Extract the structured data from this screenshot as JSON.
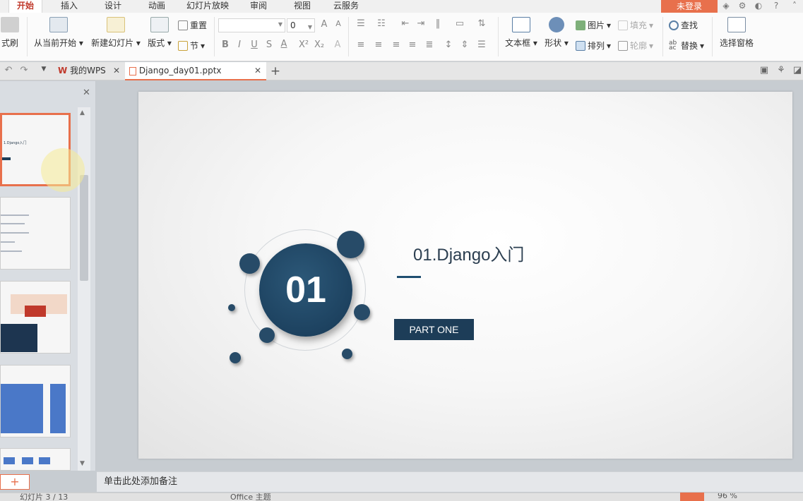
{
  "menu_tabs": [
    {
      "label": "开始",
      "active": true
    },
    {
      "label": "插入"
    },
    {
      "label": "设计"
    },
    {
      "label": "动画"
    },
    {
      "label": "幻灯片放映"
    },
    {
      "label": "审阅"
    },
    {
      "label": "视图"
    },
    {
      "label": "云服务"
    }
  ],
  "login_label": "未登录",
  "ribbon": {
    "format_painter": "式刷",
    "from_current": "从当前开始",
    "new_slide": "新建幻灯片",
    "layout": "版式",
    "reset": "重置",
    "section": "节",
    "font_size": "0",
    "textbox": "文本框",
    "shape": "形状",
    "picture": "图片",
    "fill": "填充",
    "arrange": "排列",
    "outline": "轮廓",
    "find": "查找",
    "replace": "替换",
    "select_pane": "选择窗格"
  },
  "tabs": {
    "wps_home": "我的WPS",
    "document": "Django_day01.pptx"
  },
  "slide": {
    "number": "01",
    "title": "01.Django入门",
    "part": "PART ONE"
  },
  "thumbs": {
    "t1_text": "1.Django入门"
  },
  "notes_placeholder": "单击此处添加备注",
  "status": {
    "slide_counter": "幻灯片 3 / 13",
    "theme": "Office 主题",
    "zoom": "96 %"
  },
  "colors": {
    "accent": "#e8704c",
    "slide_navy": "#1d3d58"
  }
}
